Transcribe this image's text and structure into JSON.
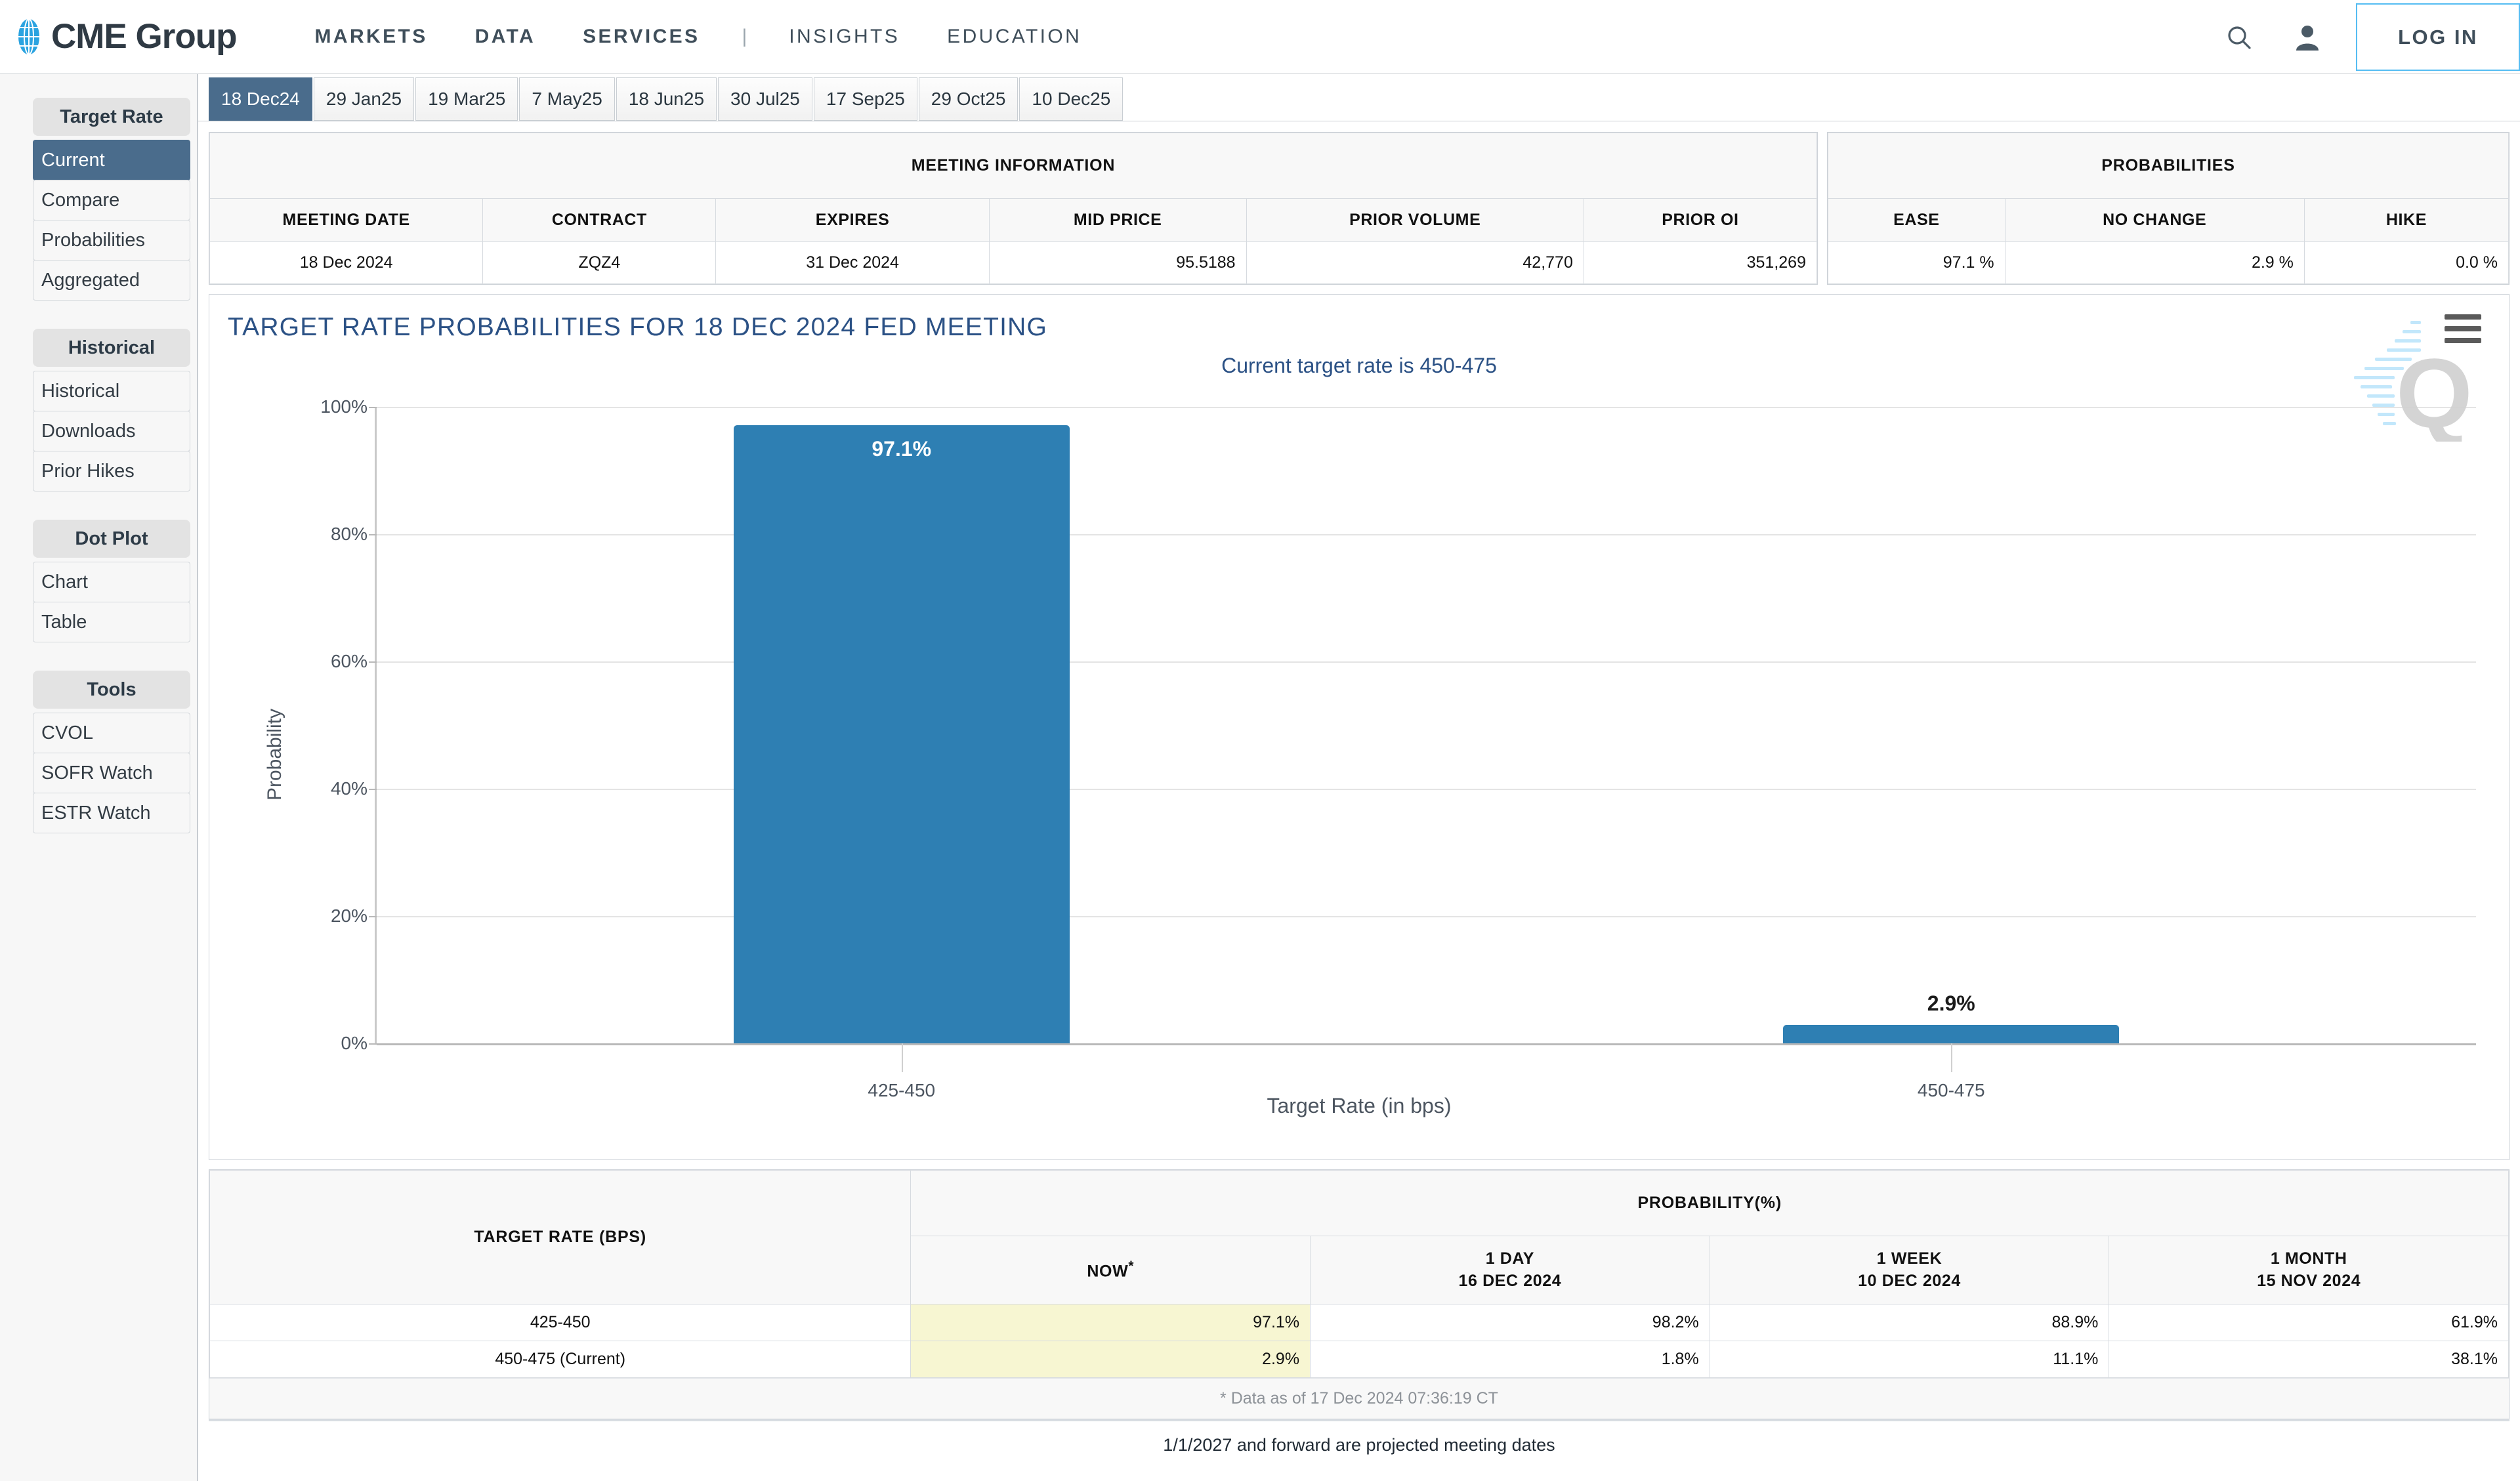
{
  "header": {
    "brand": "CME Group",
    "brand_icon": "globe-icon",
    "nav": [
      {
        "label": "MARKETS",
        "bold": true
      },
      {
        "label": "DATA",
        "bold": true
      },
      {
        "label": "SERVICES",
        "bold": true
      },
      {
        "label": "|",
        "bold": false
      },
      {
        "label": "INSIGHTS",
        "bold": false
      },
      {
        "label": "EDUCATION",
        "bold": false
      }
    ],
    "search_icon": "search-icon",
    "account_icon": "user-icon",
    "login_label": "LOG IN",
    "login_border_color": "#56bdf2"
  },
  "sidebar": {
    "groups": [
      {
        "title": "Target Rate",
        "items": [
          {
            "label": "Current",
            "active": true
          },
          {
            "label": "Compare",
            "active": false
          },
          {
            "label": "Probabilities",
            "active": false
          },
          {
            "label": "Aggregated",
            "active": false
          }
        ]
      },
      {
        "title": "Historical",
        "items": [
          {
            "label": "Historical",
            "active": false
          },
          {
            "label": "Downloads",
            "active": false
          },
          {
            "label": "Prior Hikes",
            "active": false
          }
        ]
      },
      {
        "title": "Dot Plot",
        "items": [
          {
            "label": "Chart",
            "active": false
          },
          {
            "label": "Table",
            "active": false
          }
        ]
      },
      {
        "title": "Tools",
        "items": [
          {
            "label": "CVOL",
            "active": false
          },
          {
            "label": "SOFR Watch",
            "active": false
          },
          {
            "label": "ESTR Watch",
            "active": false
          }
        ]
      }
    ]
  },
  "tabs": [
    {
      "label": "18 Dec24",
      "active": true
    },
    {
      "label": "29 Jan25",
      "active": false
    },
    {
      "label": "19 Mar25",
      "active": false
    },
    {
      "label": "7 May25",
      "active": false
    },
    {
      "label": "18 Jun25",
      "active": false
    },
    {
      "label": "30 Jul25",
      "active": false
    },
    {
      "label": "17 Sep25",
      "active": false
    },
    {
      "label": "29 Oct25",
      "active": false
    },
    {
      "label": "10 Dec25",
      "active": false
    }
  ],
  "meeting_information": {
    "caption": "MEETING INFORMATION",
    "columns": [
      "MEETING DATE",
      "CONTRACT",
      "EXPIRES",
      "MID PRICE",
      "PRIOR VOLUME",
      "PRIOR OI"
    ],
    "row": [
      "18 Dec 2024",
      "ZQZ4",
      "31 Dec 2024",
      "95.5188",
      "42,770",
      "351,269"
    ]
  },
  "probabilities": {
    "caption": "PROBABILITIES",
    "columns": [
      "EASE",
      "NO CHANGE",
      "HIKE"
    ],
    "row": [
      "97.1 %",
      "2.9 %",
      "0.0 %"
    ]
  },
  "chart_panel": {
    "title": "TARGET RATE PROBABILITIES FOR 18 DEC 2024 FED MEETING",
    "menu_icon": "hamburger-menu-icon",
    "subtitle": "Current target rate is 450-475",
    "watermark": "quikstrike-q-watermark"
  },
  "chart_data": {
    "type": "bar",
    "title": "TARGET RATE PROBABILITIES FOR 18 DEC 2024 FED MEETING",
    "subtitle": "Current target rate is 450-475",
    "categories": [
      "425-450",
      "450-475"
    ],
    "values": [
      97.1,
      2.9
    ],
    "data_labels": [
      "97.1%",
      "2.9%"
    ],
    "xlabel": "Target Rate (in bps)",
    "ylabel": "Probability",
    "ylim": [
      0,
      100
    ],
    "yticks": [
      0,
      20,
      40,
      60,
      80,
      100
    ],
    "ytick_labels": [
      "0%",
      "20%",
      "40%",
      "60%",
      "80%",
      "100%"
    ],
    "grid": true,
    "legend": "none",
    "bar_color": "#2e7fb3"
  },
  "bottom_table": {
    "left_caption": "TARGET RATE (BPS)",
    "right_caption": "PROBABILITY(%)",
    "columns": [
      {
        "line1": "NOW",
        "line2": "*"
      },
      {
        "line1": "1 DAY",
        "line2": "16 DEC 2024"
      },
      {
        "line1": "1 WEEK",
        "line2": "10 DEC 2024"
      },
      {
        "line1": "1 MONTH",
        "line2": "15 NOV 2024"
      }
    ],
    "rows": [
      {
        "rate": "425-450",
        "now": "97.1%",
        "one_day": "98.2%",
        "one_week": "88.9%",
        "one_month": "61.9%"
      },
      {
        "rate": "450-475 (Current)",
        "now": "2.9%",
        "one_day": "1.8%",
        "one_week": "11.1%",
        "one_month": "38.1%"
      }
    ],
    "as_of": "* Data as of 17 Dec 2024 07:36:19 CT"
  },
  "footer_note": "1/1/2027 and forward are projected meeting dates"
}
